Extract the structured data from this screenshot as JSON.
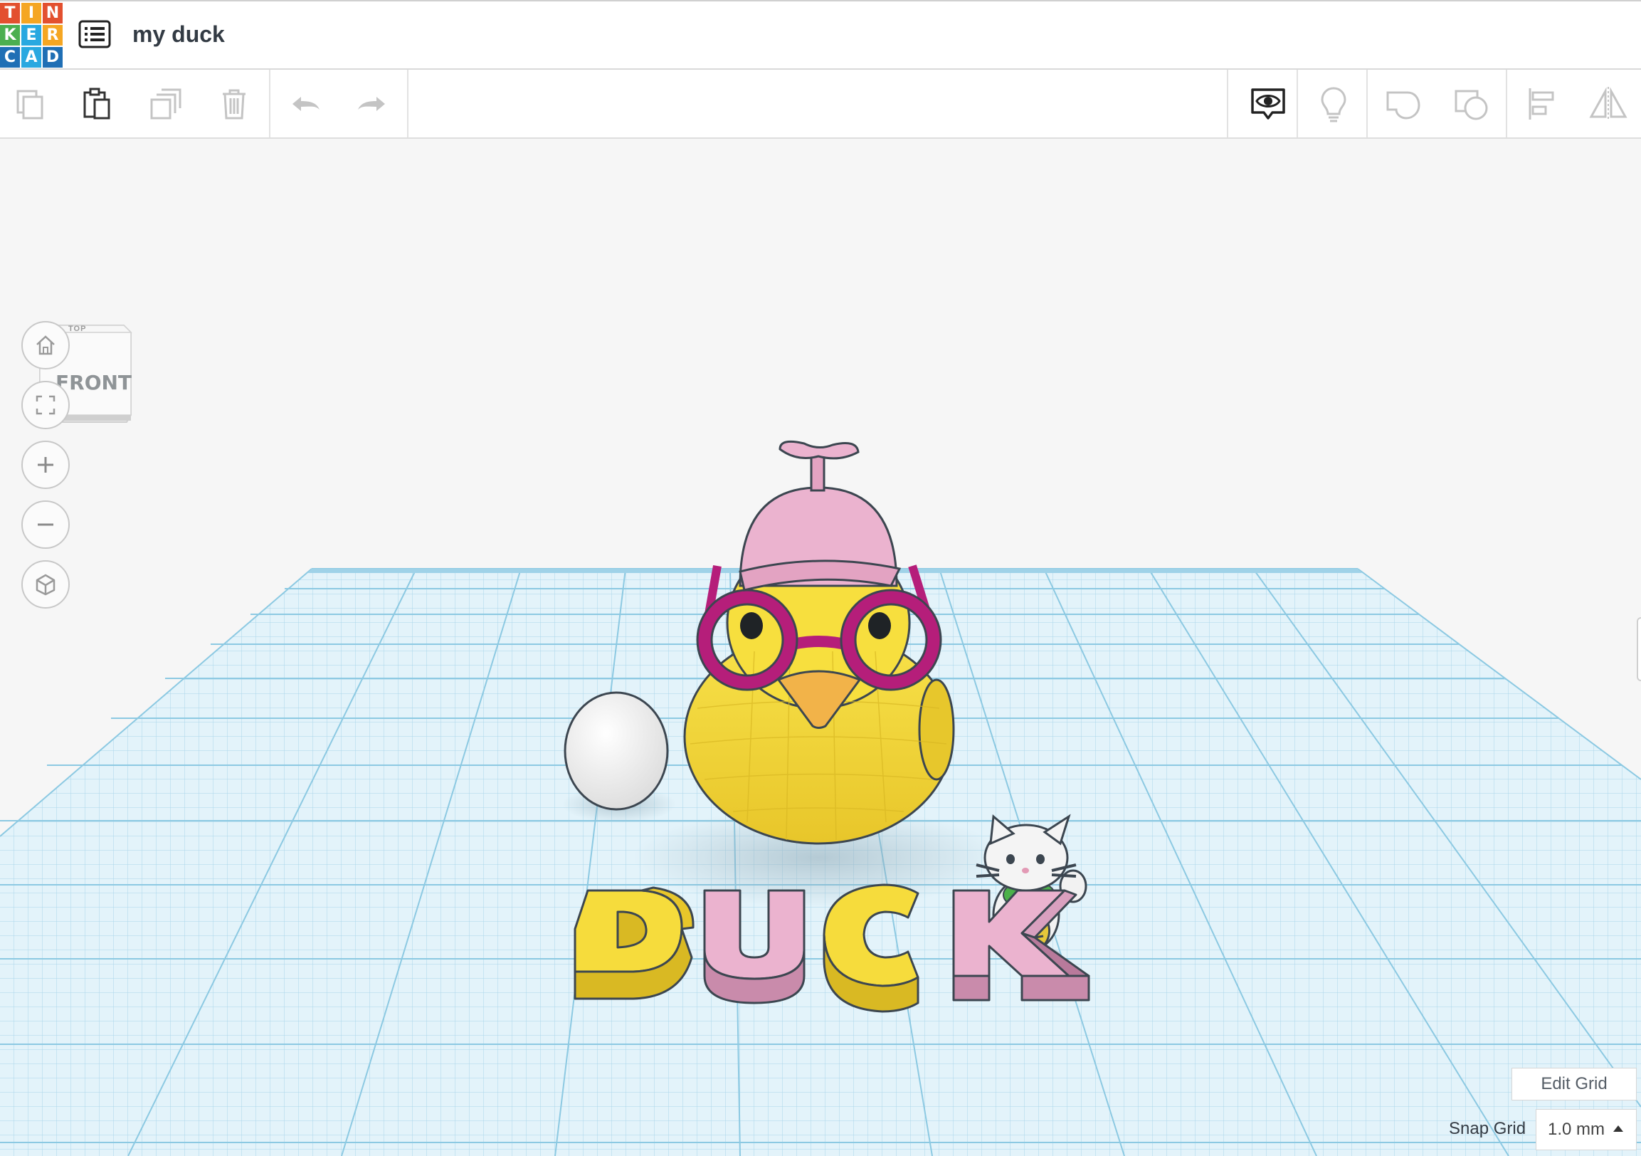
{
  "app": {
    "logo_letters": [
      "T",
      "I",
      "N",
      "K",
      "E",
      "R",
      "C",
      "A",
      "D"
    ],
    "logo_colors": [
      "#e3502f",
      "#f5a623",
      "#e3502f",
      "#4caf50",
      "#29a8e0",
      "#f5a623",
      "#1f6fb5",
      "#29a8e0",
      "#1f6fb5"
    ],
    "document_title": "my duck"
  },
  "toolbar": {
    "left_tools": [
      "copy-icon",
      "paste-icon",
      "duplicate-icon",
      "delete-icon",
      "undo-icon",
      "redo-icon"
    ],
    "right_tools": [
      "show-all-icon",
      "lightbulb-icon",
      "group-icon",
      "ungroup-icon",
      "align-icon",
      "mirror-icon"
    ]
  },
  "viewcube": {
    "front_label": "FRONT",
    "top_label": "TOP"
  },
  "nav_controls": [
    "home-view-icon",
    "fit-view-icon",
    "zoom-in-icon",
    "zoom-out-icon",
    "ortho-view-icon"
  ],
  "workplane": {
    "grid_color": "#7fc3e0",
    "plane_color": "#dff1f9"
  },
  "scene": {
    "text_object": "DUCK",
    "objects": [
      "egg",
      "duck",
      "propeller-hat",
      "glasses",
      "lucky-cat",
      "duck-letters"
    ],
    "colors": {
      "duck": "#f6dc3c",
      "hat": "#ebb3cf",
      "glasses": "#b51e7a",
      "beak": "#f2b349",
      "egg": "#f7f7f7"
    }
  },
  "grid_controls": {
    "edit_grid_label": "Edit Grid",
    "snap_grid_label": "Snap Grid",
    "snap_grid_value": "1.0 mm"
  }
}
